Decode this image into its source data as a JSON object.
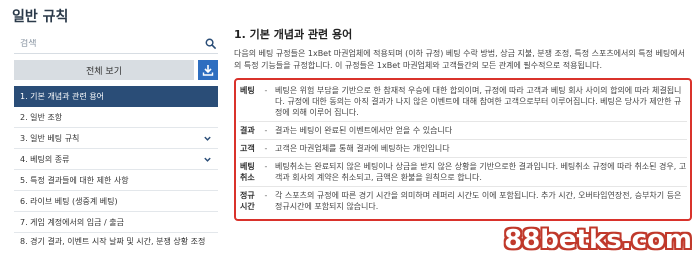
{
  "page": {
    "title": "일반 규칙"
  },
  "sidebar": {
    "search_placeholder": "검색",
    "full_view_label": "전체 보기",
    "menu": [
      {
        "label": "1. 기본 개념과 관련 용어",
        "active": true,
        "expandable": false
      },
      {
        "label": "2. 일반 조항",
        "active": false,
        "expandable": false
      },
      {
        "label": "3. 일반 베팅 규칙",
        "active": false,
        "expandable": true
      },
      {
        "label": "4. 베팅의 종류",
        "active": false,
        "expandable": true
      },
      {
        "label": "5. 특정 결과들에 대한 제한 사항",
        "active": false,
        "expandable": false
      },
      {
        "label": "6. 라이브 베팅 (생중계 베팅)",
        "active": false,
        "expandable": false
      },
      {
        "label": "7. 게임 계정에서의 입금 / 출금",
        "active": false,
        "expandable": false
      },
      {
        "label": "8. 경기 결과, 이벤트 시작 날짜 및 시간, 분쟁 상황 조정",
        "active": false,
        "expandable": false
      }
    ]
  },
  "main": {
    "heading": "1. 기본 개념과 관련 용어",
    "intro": "다음의 베팅 규정들은 1xBet 마권업체에 적용되며 (이하 규정) 베팅 수락 방법, 상금 지불, 분쟁 조정, 특정 스포츠에서의 특정 베팅에서의 특정 기능들을 규정합니다. 이 규정들은 1xBet 마권업체와 고객들간의 모든 관계에 필수적으로 적용됩니다.",
    "terms": [
      {
        "name": "베팅",
        "definition": "베팅은 위험 부담을 기반으로 한 참재적 우승에 대한 합의이며, 규정에 따라 고객과 베팅 회사 사이의 합의에 따라 체결됩니다. 규정에 대한 동의는 아직 결과가 나지 않은 이벤트에 대해 참여한 고객으로부터 이루어집니다. 베팅은 당사가 제안한 규정에 의해 이루어 집니다."
      },
      {
        "name": "결과",
        "definition": "결과는 베팅이 완료된 이벤트에서만 얻을 수 있습니다"
      },
      {
        "name": "고객",
        "definition": "고객은 마권업체를 통해 결과에 베팅하는 개인입니다"
      },
      {
        "name": "베팅 취소",
        "definition": "베팅취소는 완료되지 않은 베팅이나 상금을 받지 않은 상황을 기반으로한 결과입니다. 베팅취소 규정에 따라 취소된 경우, 고객과 회사의 계약은 취소되고, 금액은 환불을 원칙으로 합니다."
      },
      {
        "name": "정규 시간",
        "definition": "각 스포츠의 규정에 따른 경기 시간을 의미하며 레퍼리 시간도 이에 포함됩니다. 추가 시간, 오버타임연장전, 승부차기 등은 정규시간에 포함되지 않습니다."
      }
    ]
  },
  "watermark": "88betks.com",
  "colors": {
    "accent": "#2e6ec0",
    "active_menu": "#2a4d77",
    "highlight_border": "#d9322b"
  }
}
